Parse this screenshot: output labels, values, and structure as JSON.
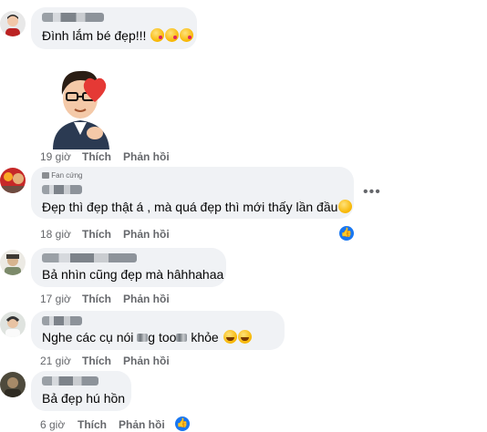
{
  "comments": [
    {
      "text": "Đình lắm bé đẹp!!!",
      "emojis": [
        "kiss",
        "kiss",
        "kiss"
      ],
      "sticker": "man-finger-heart-sticker",
      "time": "19 giờ",
      "like": "Thích",
      "reply": "Phản hồi"
    },
    {
      "badge": "Fan cứng",
      "text": "Đẹp thì đẹp thật á , mà quá đẹp thì mới thấy lần đầu",
      "emojis": [
        "heart-eyes"
      ],
      "time": "18 giờ",
      "like": "Thích",
      "reply": "Phản hồi",
      "reaction": "like"
    },
    {
      "text": "Bả nhìn cũng đẹp mà hâhhahaa",
      "time": "17 giờ",
      "like": "Thích",
      "reply": "Phản hồi"
    },
    {
      "text_parts": [
        "Nghe các cụ nói ",
        "g too",
        " khỏe"
      ],
      "emojis": [
        "laugh",
        "laugh"
      ],
      "time": "21 giờ",
      "like": "Thích",
      "reply": "Phản hồi"
    },
    {
      "text": "Bả đẹp hú hồn",
      "time": "6 giờ",
      "like": "Thích",
      "reply": "Phản hồi",
      "reaction": "like"
    }
  ],
  "colors": {
    "bubble": "#f0f2f5",
    "meta": "#65676b",
    "like": "#1877f2"
  }
}
